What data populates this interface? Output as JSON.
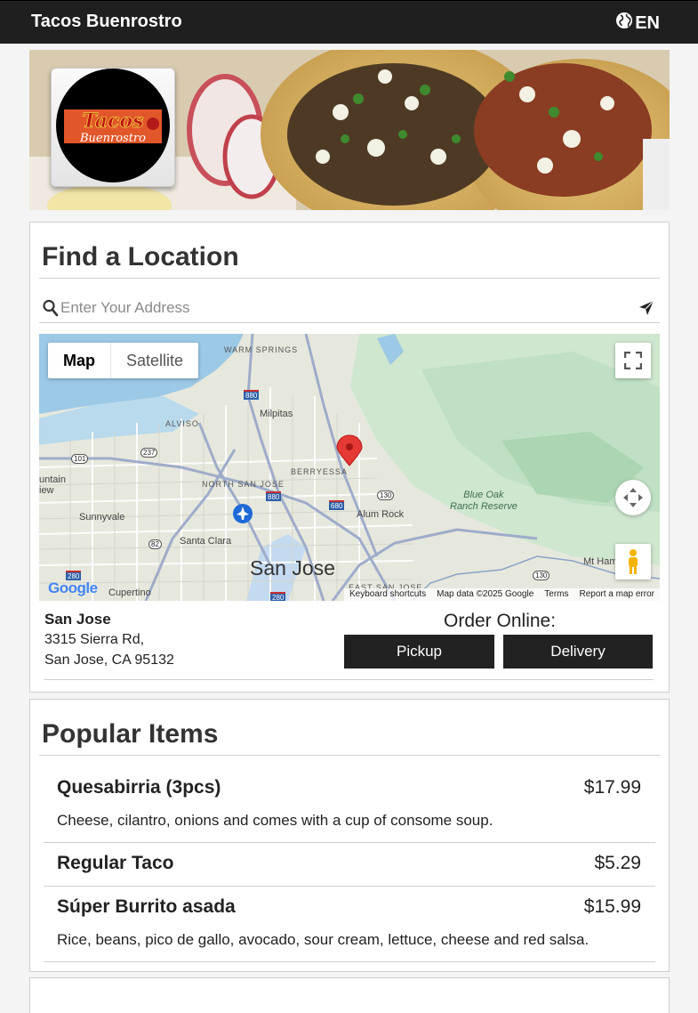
{
  "header": {
    "brand": "Tacos Buenrostro",
    "language": "EN"
  },
  "hero": {
    "logo_text_top": "Tacos",
    "logo_text_bottom": "Buenrostro"
  },
  "find": {
    "title": "Find a Location",
    "search_placeholder": "Enter Your Address"
  },
  "map": {
    "map_label": "Map",
    "satellite_label": "Satellite",
    "labels": {
      "warm_springs": "WARM SPRINGS",
      "milpitas": "Milpitas",
      "alviso": "ALVISO",
      "berryessa": "BERRYESSA",
      "north_san_jose": "NORTH SAN JOSE",
      "mountain_view": "untain\niew",
      "sunnyvale": "Sunnyvale",
      "santa_clara": "Santa Clara",
      "san_jose": "San Jose",
      "alum_rock": "Alum Rock",
      "blue_oak": "Blue Oak\nRanch Reserve",
      "mt_ham": "Mt Ham",
      "cupertino": "Cupertino",
      "east_san_jose": "EAST SAN JOSE",
      "r880": "880",
      "r237": "237",
      "r101": "101",
      "r680": "680",
      "r130": "130",
      "r82": "82",
      "r280": "280"
    },
    "google": "Google",
    "attribution": [
      "Keyboard shortcuts",
      "Map data ©2025 Google",
      "Terms",
      "Report a map error"
    ]
  },
  "location": {
    "name": "San Jose",
    "address1": "3315 Sierra Rd,",
    "address2": "San Jose, CA 95132",
    "order_label": "Order Online:",
    "pickup": "Pickup",
    "delivery": "Delivery"
  },
  "popular": {
    "title": "Popular Items",
    "items": [
      {
        "name": "Quesabirria (3pcs)",
        "price": "$17.99",
        "desc": "Cheese, cilantro, onions and comes with a cup of consome soup."
      },
      {
        "name": "Regular Taco",
        "price": "$5.29",
        "desc": ""
      },
      {
        "name": "Súper Burrito asada",
        "price": "$15.99",
        "desc": "Rice, beans, pico de gallo, avocado, sour cream, lettuce, cheese and red salsa."
      }
    ]
  },
  "colors": {
    "topbar": "#1f1f1f",
    "button": "#222222",
    "map_pin": "#e53935"
  }
}
